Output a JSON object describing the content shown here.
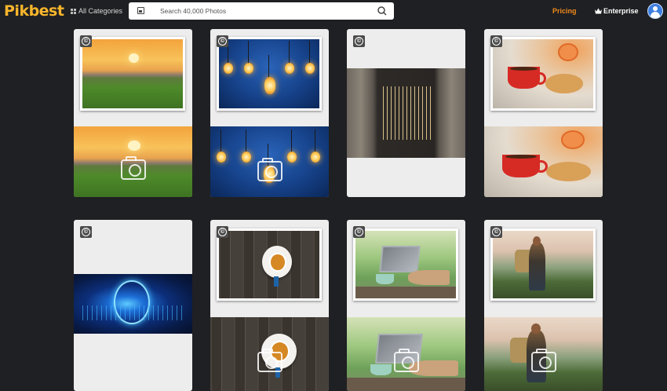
{
  "header": {
    "logo": "Pikbest",
    "categories_label": "All Categories",
    "search_placeholder": "Search 40,000 Photos",
    "pricing_label": "Pricing",
    "enterprise_label": "Enterprise"
  },
  "cards": [
    {
      "id": "sunset-field",
      "copyright": "©"
    },
    {
      "id": "light-bulbs",
      "copyright": "©"
    },
    {
      "id": "wood-panels",
      "copyright": "©"
    },
    {
      "id": "coffee-croissant",
      "copyright": "©"
    },
    {
      "id": "tech-brain",
      "copyright": "©"
    },
    {
      "id": "coffee-cup-top",
      "copyright": "©"
    },
    {
      "id": "laptop-desk",
      "copyright": "©"
    },
    {
      "id": "hiker",
      "copyright": "©"
    }
  ],
  "icons": {
    "search": "search-icon",
    "image_search": "image-search-icon",
    "crown": "crown-icon",
    "camera": "camera-icon",
    "copyright": "copyright-icon"
  },
  "colors": {
    "brand": "#f7b52c",
    "pricing": "#f08a1c",
    "background": "#1f2023",
    "card": "#ededed"
  }
}
